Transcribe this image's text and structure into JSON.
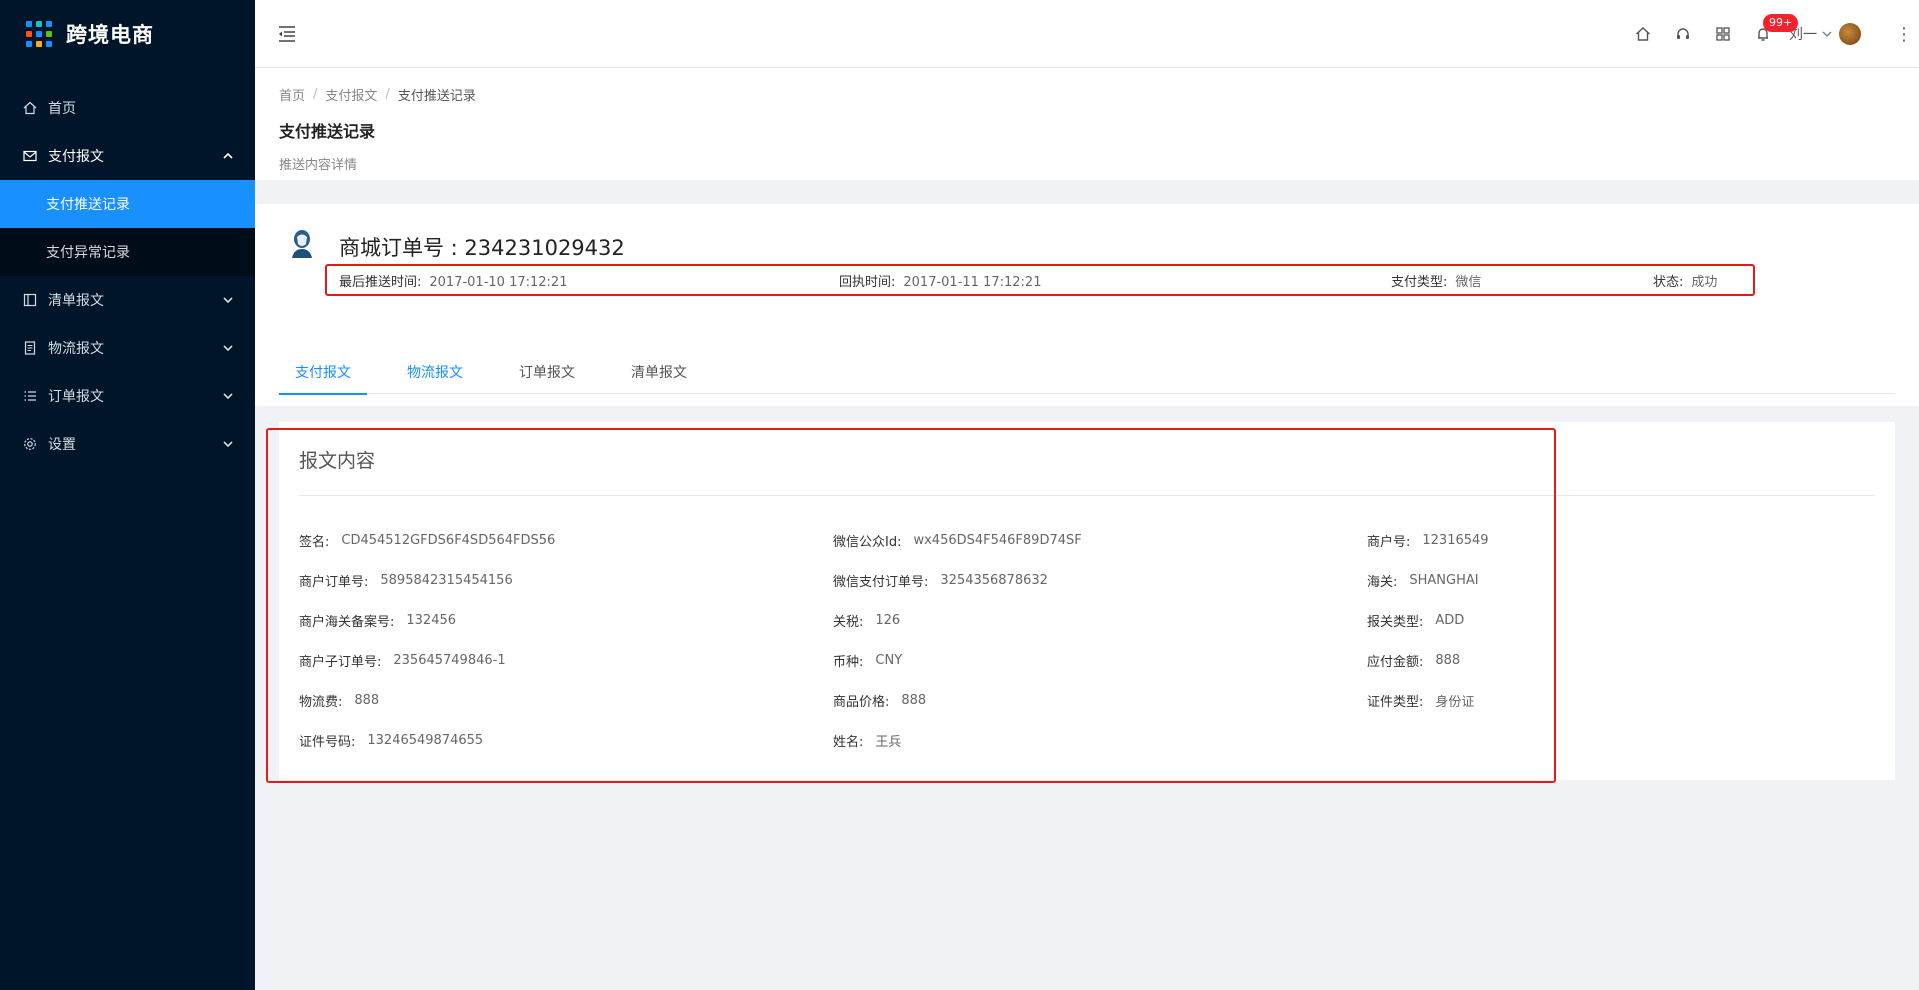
{
  "app": {
    "name": "跨境电商",
    "logo_colors": [
      "#1890ff",
      "#13c2c2",
      "#1890ff",
      "#fa541c",
      "#1890ff",
      "#52c41a",
      "#1890ff",
      "#faad14",
      "#1890ff"
    ]
  },
  "sidebar": {
    "items": [
      {
        "label": "首页",
        "icon": "home-icon"
      },
      {
        "label": "支付报文",
        "icon": "mail-icon",
        "open": true,
        "children": [
          {
            "label": "支付推送记录",
            "active": true
          },
          {
            "label": "支付异常记录"
          }
        ]
      },
      {
        "label": "清单报文",
        "icon": "list-box-icon"
      },
      {
        "label": "物流报文",
        "icon": "doc-icon"
      },
      {
        "label": "订单报文",
        "icon": "bullet-list-icon"
      },
      {
        "label": "设置",
        "icon": "gear-icon"
      }
    ]
  },
  "header": {
    "badge": "99+",
    "user": "刘一"
  },
  "breadcrumb": [
    "首页",
    "支付报文",
    "支付推送记录"
  ],
  "page": {
    "title": "支付推送记录",
    "subtitle": "推送内容详情"
  },
  "order": {
    "title": "商城订单号 : 234231029432",
    "last_push_label": "最后推送时间:",
    "last_push_value": "2017-01-10 17:12:21",
    "receipt_label": "回执时间:",
    "receipt_value": "2017-01-11 17:12:21",
    "pay_type_label": "支付类型:",
    "pay_type_value": "微信",
    "status_label": "状态:",
    "status_value": "成功"
  },
  "tabs": [
    "支付报文",
    "物流报文",
    "订单报文",
    "清单报文"
  ],
  "card": {
    "title": "报文内容",
    "fields": [
      {
        "label": "签名:",
        "value": "CD454512GFDS6F4SD564FDS56"
      },
      {
        "label": "微信公众Id:",
        "value": "wx456DS4F546F89D74SF"
      },
      {
        "label": "商户号:",
        "value": "12316549"
      },
      {
        "label": "商户订单号:",
        "value": "5895842315454156"
      },
      {
        "label": "微信支付订单号:",
        "value": "3254356878632"
      },
      {
        "label": "海关:",
        "value": "SHANGHAI"
      },
      {
        "label": "商户海关备案号:",
        "value": "132456"
      },
      {
        "label": "关税:",
        "value": "126"
      },
      {
        "label": "报关类型:",
        "value": "ADD"
      },
      {
        "label": "商户子订单号:",
        "value": "235645749846-1"
      },
      {
        "label": "币种:",
        "value": "CNY"
      },
      {
        "label": "应付金额:",
        "value": "888"
      },
      {
        "label": "物流费:",
        "value": "888"
      },
      {
        "label": "商品价格:",
        "value": "888"
      },
      {
        "label": "证件类型:",
        "value": "身份证"
      },
      {
        "label": "证件号码:",
        "value": "13246549874655"
      },
      {
        "label": "姓名:",
        "value": "王兵"
      }
    ]
  },
  "colors": {
    "sidebar_bg": "#001529",
    "accent": "#1890ff",
    "highlight_border": "#e21b1b",
    "badge": "#f5222d"
  }
}
